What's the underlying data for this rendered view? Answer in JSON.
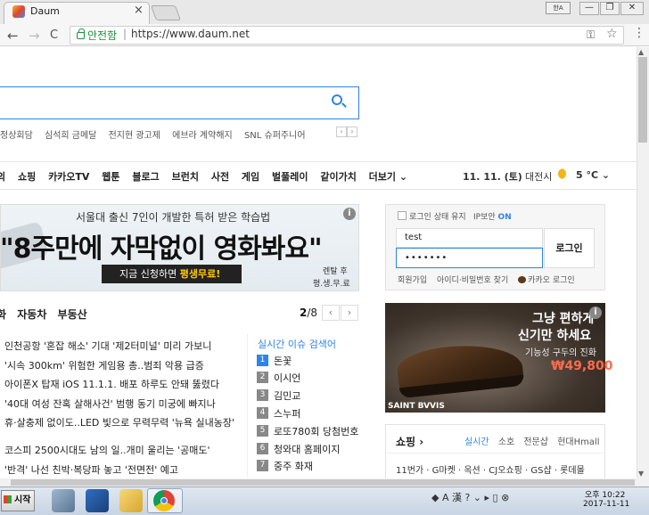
{
  "browser": {
    "tab_title": "Daum",
    "tab_close": "×",
    "ime_label": "한A",
    "win_min": "—",
    "win_restore": "❐",
    "win_close": "✕",
    "back": "←",
    "forward": "→",
    "reload": "C",
    "secure_label": "안전함",
    "url_sep": "|",
    "url": "https://www.daum.net",
    "key_glyph": "⚿",
    "star_glyph": "☆",
    "menu_glyph": "⋮"
  },
  "search": {
    "trending": [
      "정상회담",
      "심석희 금메달",
      "전지현 광고제",
      "에브라 계약해지",
      "SNL 슈퍼주니어"
    ],
    "prev": "‹",
    "next": "›"
  },
  "gnb": {
    "items": [
      "의",
      "쇼핑",
      "카카오TV",
      "웹툰",
      "블로그",
      "브런치",
      "사전",
      "게임",
      "벌풀레이",
      "같이가치",
      "더보기 ⌄"
    ],
    "date": "11. 11. (토)",
    "location": "대전시",
    "temp": "5 °C ⌄"
  },
  "banner": {
    "sub": "서울대 출신 7인이 개발한 특허 받은 학습법",
    "main": "\"8주만에 자막없이 영화봐요\"",
    "cta_prefix": "지금 신청하면 ",
    "cta_strong": "평생무료!",
    "tag1": "렌탈 후",
    "tag2": "평.생.무.료",
    "info": "i"
  },
  "news": {
    "tabs": [
      "화",
      "자동차",
      "부동산"
    ],
    "page_current": "2",
    "page_total": "/8",
    "prev": "‹",
    "next": "›",
    "items": [
      "인천공항 '혼잡 해소' 기대 '제2터미널' 미리 가보니",
      "'시속 300km' 위험한 게임용 총..범죄 악용 급증",
      "아이폰X 탑재 iOS 11.1.1. 배포 하루도 안돼 뚫렸다",
      "'40대 여성 잔혹 살해사건' 범행 동기 미궁에 빠지나",
      "휴·살충제 없이도..LED 빛으로 무력무력 '뉴욕 실내농장'",
      "코스피 2500시대도 남의 일..개미 울리는 '공매도'",
      "'반격' 나선 친박·복당파 놓고 '전면전' 예고"
    ]
  },
  "realtime": {
    "title": "실시간 이슈 검색어",
    "items": [
      {
        "rank": "1",
        "label": "돈꽃"
      },
      {
        "rank": "2",
        "label": "이시언"
      },
      {
        "rank": "3",
        "label": "김민교"
      },
      {
        "rank": "4",
        "label": "스누퍼"
      },
      {
        "rank": "5",
        "label": "로또780회 당첨번호"
      },
      {
        "rank": "6",
        "label": "청와대 홈페이지"
      },
      {
        "rank": "7",
        "label": "중주 화재"
      }
    ]
  },
  "login": {
    "keep_label": "로그인 상태 유지",
    "ip_label": "IP보안",
    "ip_state": "ON",
    "id_value": "test",
    "pw_value": "•••••••",
    "button": "로그인",
    "join": "회원가입",
    "find": "아이디·비밀번호 찾기",
    "kakao": "카카오 로그인"
  },
  "shoe_ad": {
    "line1": "그냥 편하게",
    "line2": "신기만 하세요",
    "line3": "기능성 구두의 진화",
    "price": "₩49,800",
    "brand": "SAINT BVVIS",
    "info": "i"
  },
  "shopping": {
    "title": "쇼핑 ›",
    "tabs": [
      "실시간",
      "소호",
      "전문샵",
      "현대Hmall"
    ],
    "row": "11번가 · G마켓 · 옥션 · CJ오쇼핑 · GS샵 · 롯데몰"
  },
  "taskbar": {
    "start": "시작",
    "tray": "◆ A 漢  ?  ⌄  ▸ ▯ ⊗",
    "time": "오후 10:22",
    "date": "2017-11-11"
  }
}
